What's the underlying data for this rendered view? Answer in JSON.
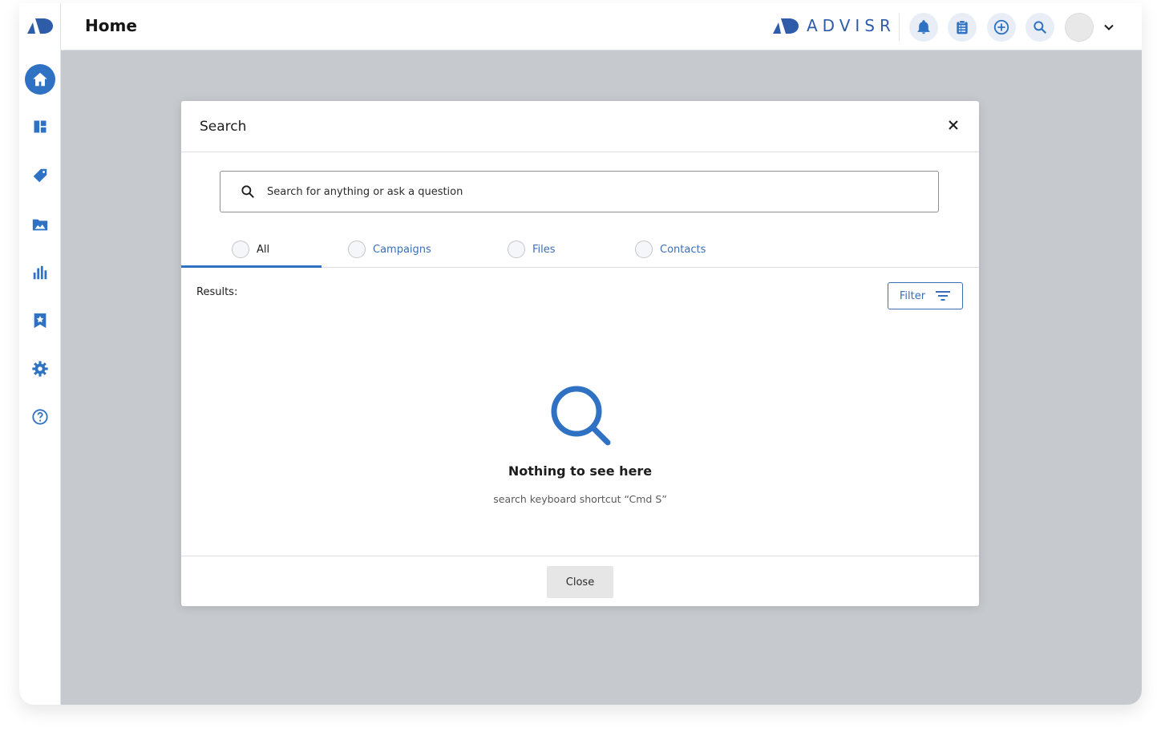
{
  "header": {
    "title": "Home",
    "brand_name": "ADVISR"
  },
  "colors": {
    "accent": "#2f72c4",
    "overlay": "#c6c9ce"
  },
  "sidebar": {
    "items": [
      {
        "icon": "home-icon",
        "active": true
      },
      {
        "icon": "dashboard-icon"
      },
      {
        "icon": "tag-icon"
      },
      {
        "icon": "image-folder-icon"
      },
      {
        "icon": "bar-chart-icon"
      },
      {
        "icon": "bookmark-star-icon"
      },
      {
        "icon": "gear-icon"
      },
      {
        "icon": "help-icon"
      }
    ]
  },
  "toolbar": {
    "icons": [
      "bell-icon",
      "clipboard-icon",
      "add-circle-icon",
      "search-icon",
      "avatar",
      "chevron-down-icon"
    ]
  },
  "modal": {
    "title": "Search",
    "search_placeholder": "Search for anything or ask a question",
    "tabs": [
      {
        "label": "All",
        "active": true
      },
      {
        "label": "Campaigns"
      },
      {
        "label": "Files"
      },
      {
        "label": "Contacts"
      }
    ],
    "results_label": "Results:",
    "filter_label": "Filter",
    "empty_title": "Nothing to see here",
    "empty_subtitle": "search keyboard shortcut “Cmd S”",
    "close_label": "Close"
  }
}
